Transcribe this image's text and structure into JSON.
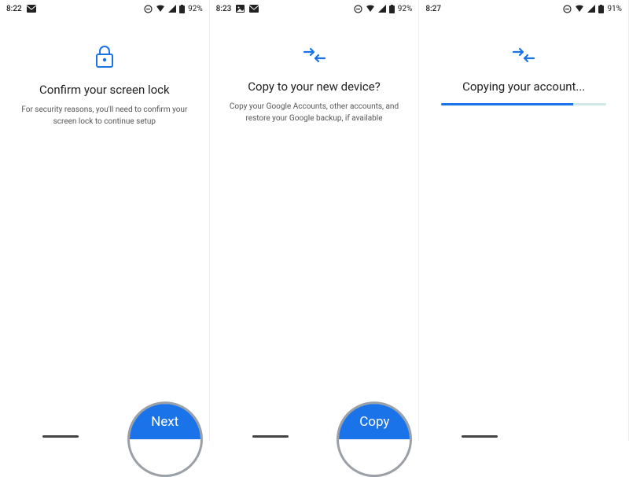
{
  "colors": {
    "accent": "#1a73e8",
    "gray": "#9aa0a6"
  },
  "screens": [
    {
      "status": {
        "time": "8:22",
        "battery": "92%",
        "icons": [
          "envelope"
        ]
      },
      "icon": "lock",
      "title": "Confirm your screen lock",
      "subtitle": "For security reasons, you'll need to confirm your screen lock to continue setup",
      "button": "Next"
    },
    {
      "status": {
        "time": "8:23",
        "battery": "92%",
        "icons": [
          "image",
          "envelope"
        ]
      },
      "icon": "arrows",
      "title": "Copy to your new device?",
      "subtitle": "Copy your Google Accounts, other accounts, and restore your Google backup, if available",
      "button": "Copy"
    },
    {
      "status": {
        "time": "8:27",
        "battery": "91%",
        "icons": []
      },
      "icon": "arrows",
      "title": "Copying your account...",
      "progress": 80
    }
  ]
}
